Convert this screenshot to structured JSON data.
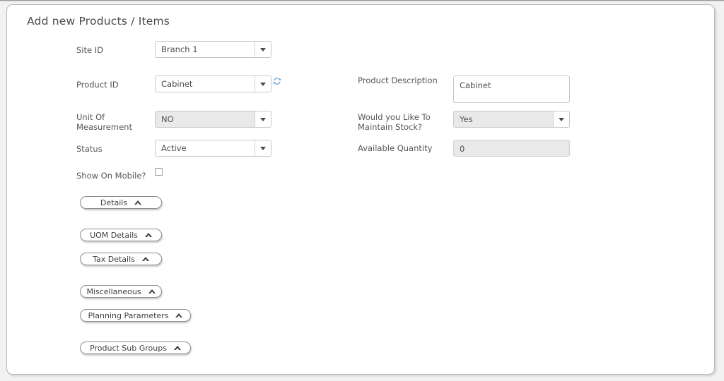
{
  "page": {
    "title": "Add new Products / Items"
  },
  "form": {
    "left": {
      "site_id": {
        "label": "Site ID",
        "value": "Branch 1",
        "icon": "chevron-down-icon"
      },
      "product_id": {
        "label": "Product ID",
        "value": "Cabinet",
        "icon": "chevron-down-icon",
        "refresh_icon": "refresh-icon"
      },
      "unit_of_measurement": {
        "label": "Unit Of\nMeasurement",
        "value": "NO",
        "icon": "chevron-down-icon"
      },
      "status": {
        "label": "Status",
        "value": "Active",
        "icon": "chevron-down-icon"
      },
      "show_on_mobile": {
        "label": "Show On Mobile?",
        "checked": false
      }
    },
    "right": {
      "product_description": {
        "label": "Product Description",
        "value": "Cabinet",
        "placeholder": ""
      },
      "maintain_stock": {
        "label": "Would you Like To\nMaintain Stock?",
        "value": "Yes",
        "icon": "chevron-down-icon"
      },
      "available_quantity": {
        "label": "Available Quantity",
        "value": "0"
      }
    }
  },
  "sections": [
    {
      "label": "Details",
      "icon": "chevron-up-icon"
    },
    {
      "label": "UOM Details",
      "icon": "chevron-up-icon"
    },
    {
      "label": "Tax Details",
      "icon": "chevron-up-icon"
    },
    {
      "label": "Miscellaneous",
      "icon": "chevron-up-icon"
    },
    {
      "label": "Planning Parameters",
      "icon": "chevron-up-icon"
    },
    {
      "label": "Product Sub Groups",
      "icon": "chevron-up-icon"
    }
  ],
  "colors": {
    "page_background": "#f2f2f2",
    "panel_background": "#ffffff",
    "panel_border": "#b9b9b9",
    "label_text": "#555555",
    "title_text": "#4a4a4a",
    "disabled_field": "#e9e9e9",
    "refresh_icon": "#5b9bd5"
  }
}
